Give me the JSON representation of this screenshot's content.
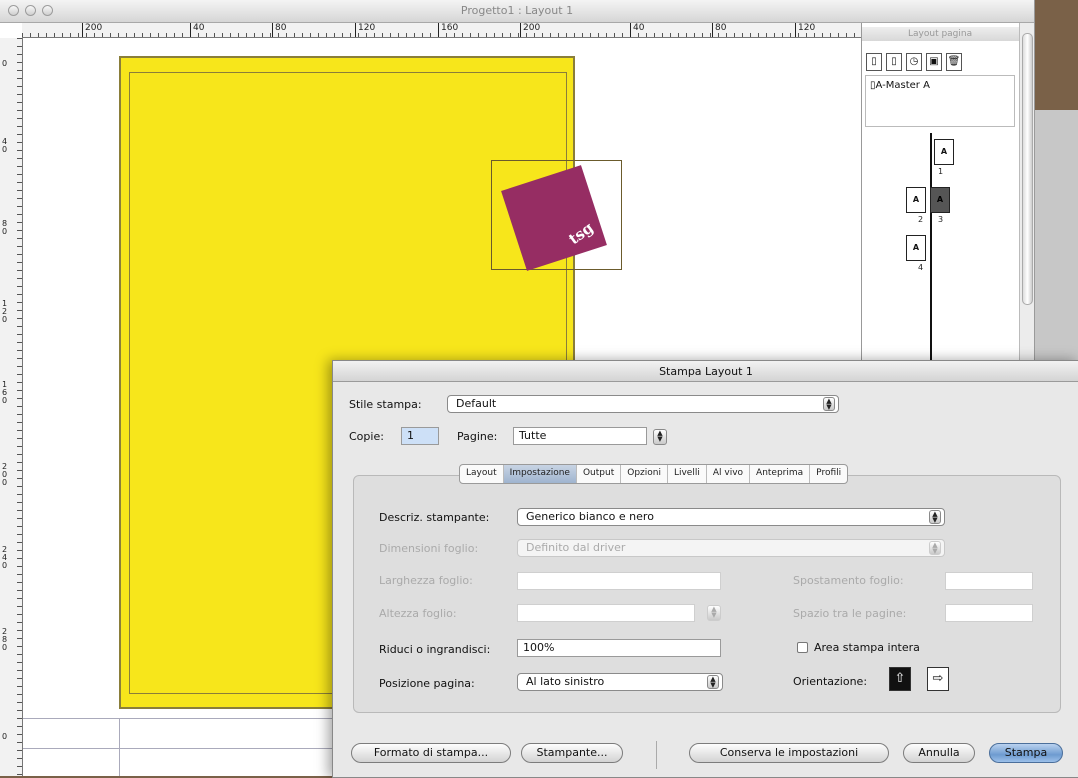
{
  "window": {
    "title": "Progetto1 : Layout 1"
  },
  "ruler": {
    "h_labels": [
      "200",
      "40",
      "80",
      "120",
      "160",
      "200",
      "40",
      "80",
      "120"
    ],
    "v_labels": [
      "0",
      "40",
      "80",
      "120",
      "160",
      "200",
      "240",
      "280",
      "0"
    ]
  },
  "document": {
    "logo_text": "tsg",
    "colors": {
      "page": "#f7e61b",
      "logo": "#962d63"
    }
  },
  "palette": {
    "title": "Layout pagina",
    "master": "A-Master A",
    "pages": [
      {
        "letter": "A",
        "num": "1"
      },
      {
        "letter": "A",
        "num": "2"
      },
      {
        "letter": "A",
        "num": "3"
      },
      {
        "letter": "A",
        "num": "4"
      }
    ]
  },
  "dialog": {
    "title": "Stampa Layout 1",
    "style_label": "Stile stampa:",
    "style_value": "Default",
    "copies_label": "Copie:",
    "copies_value": "1",
    "pages_label": "Pagine:",
    "pages_value": "Tutte",
    "tabs": [
      "Layout",
      "Impostazione",
      "Output",
      "Opzioni",
      "Livelli",
      "Al vivo",
      "Anteprima",
      "Profili"
    ],
    "active_tab": "Impostazione",
    "printer_desc_label": "Descriz. stampante:",
    "printer_desc_value": "Generico bianco e nero",
    "paper_size_label": "Dimensioni foglio:",
    "paper_size_value": "Definito dal driver",
    "paper_width_label": "Larghezza foglio:",
    "paper_height_label": "Altezza foglio:",
    "paper_offset_label": "Spostamento foglio:",
    "page_gap_label": "Spazio tra le pagine:",
    "scale_label": "Riduci o ingrandisci:",
    "scale_value": "100%",
    "full_area_label": "Area stampa intera",
    "position_label": "Posizione pagina:",
    "position_value": "Al lato sinistro",
    "orientation_label": "Orientazione:",
    "buttons": {
      "page_setup": "Formato di stampa...",
      "printer": "Stampante...",
      "save_settings": "Conserva le impostazioni",
      "cancel": "Annulla",
      "print": "Stampa"
    }
  }
}
